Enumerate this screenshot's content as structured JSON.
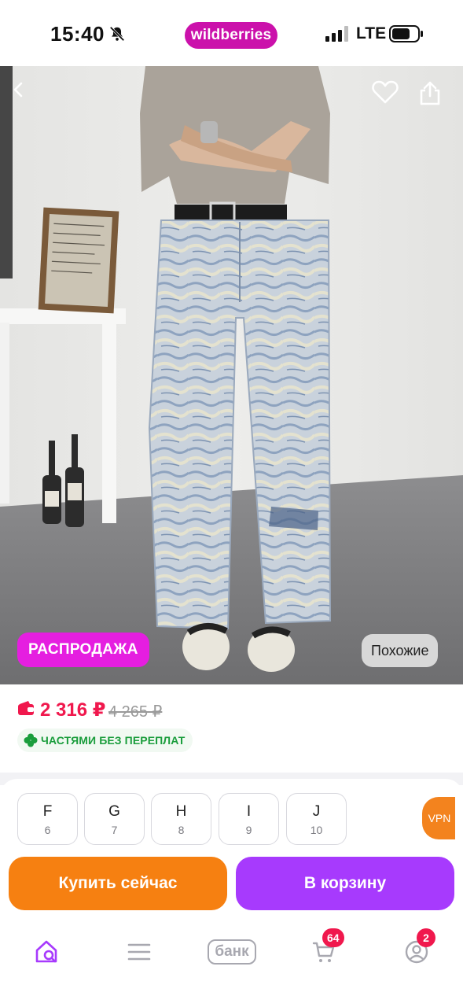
{
  "status_bar": {
    "time": "15:40",
    "network": "LTE",
    "brand_logo": "wildberries",
    "icons": [
      "bell-muted-icon",
      "signal-icon",
      "battery-icon"
    ]
  },
  "product_photo": {
    "sale_badge": "РАСПРОДАЖА",
    "similar_button": "Похожие",
    "icons": [
      "back-icon",
      "heart-icon",
      "share-icon"
    ]
  },
  "price": {
    "current": "2 316 ₽",
    "old": "4 265 ₽",
    "installment": "ЧАСТЯМИ БЕЗ ПЕРЕПЛАТ"
  },
  "sizes": [
    {
      "label": "F",
      "number": "6"
    },
    {
      "label": "G",
      "number": "7"
    },
    {
      "label": "H",
      "number": "8"
    },
    {
      "label": "I",
      "number": "9"
    },
    {
      "label": "J",
      "number": "10"
    }
  ],
  "vpn_label": "VPN",
  "actions": {
    "buy_now": "Купить сейчас",
    "add_to_cart": "В корзину"
  },
  "tabbar": {
    "bank_label": "банк",
    "cart_count": "64",
    "profile_count": "2"
  },
  "colors": {
    "brand": "#cb11ab",
    "sale_badge": "#e51ee0",
    "price": "#f0184d",
    "installment_green": "#1a9d3c",
    "buy_now": "#f68011",
    "cart": "#a73afd",
    "vpn": "#f3831e",
    "active_tab": "#a73afd"
  }
}
